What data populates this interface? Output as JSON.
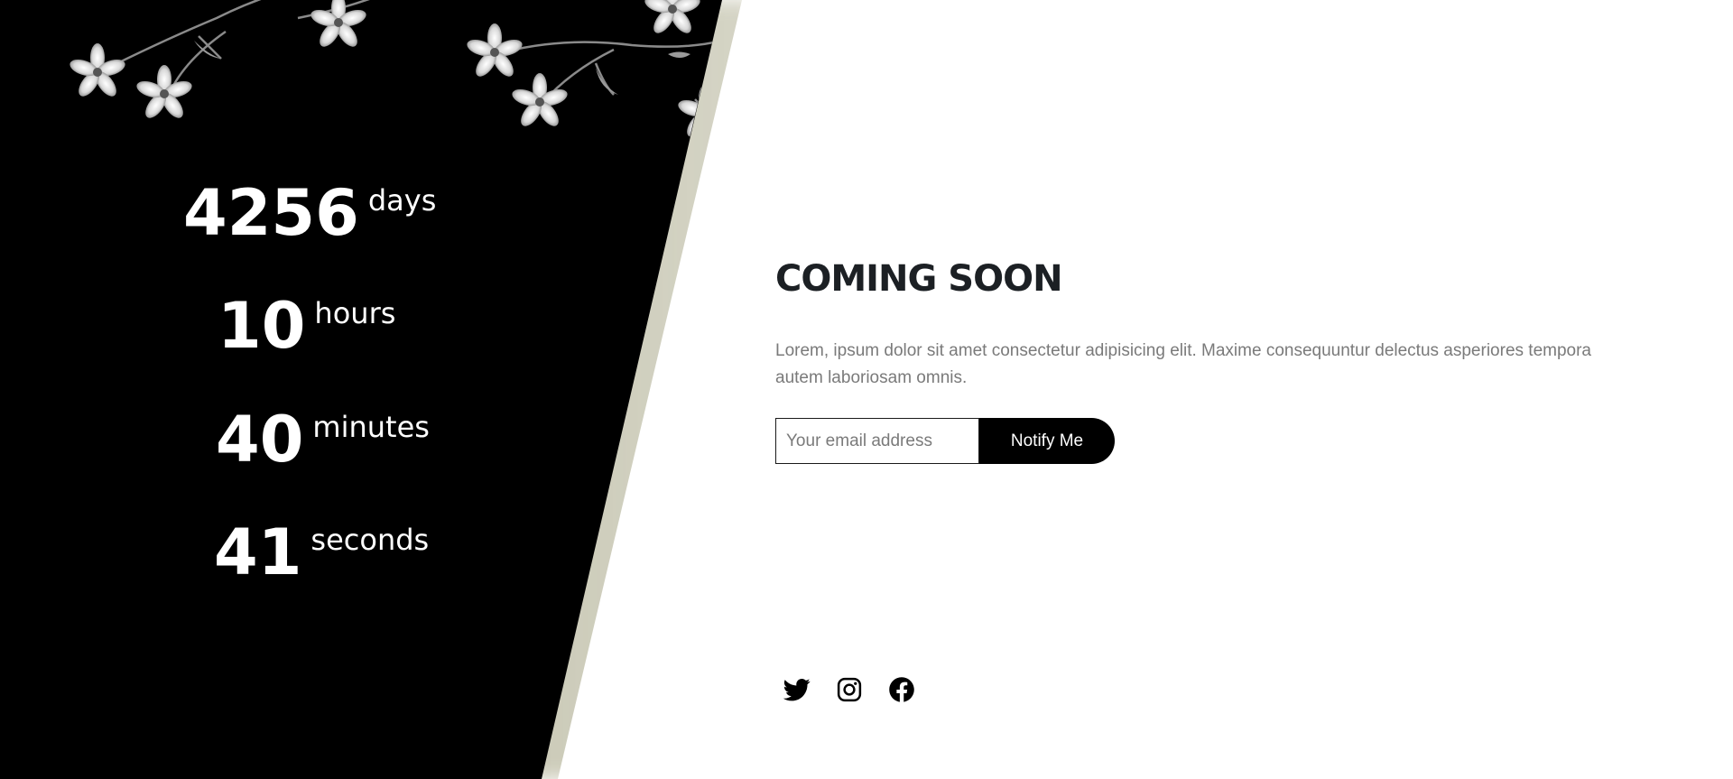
{
  "countdown": {
    "days": {
      "value": "4256",
      "unit": "days"
    },
    "hours": {
      "value": "10",
      "unit": "hours"
    },
    "minutes": {
      "value": "40",
      "unit": "minutes"
    },
    "seconds": {
      "value": "41",
      "unit": "seconds"
    }
  },
  "main": {
    "title": "COMING SOON",
    "description": "Lorem, ipsum dolor sit amet consectetur adipisicing elit. Maxime consequuntur delectus asperiores tempora autem laboriosam omnis.",
    "email_placeholder": "Your email address",
    "email_value": "",
    "notify_label": "Notify Me"
  },
  "social": [
    {
      "icon": "twitter-icon"
    },
    {
      "icon": "instagram-icon"
    },
    {
      "icon": "facebook-icon"
    }
  ],
  "colors": {
    "panel_background": "#000000",
    "page_background": "#ffffff",
    "title_color": "#1c2024",
    "text_muted": "#7a7a7a",
    "button_background": "#000000",
    "button_text": "#ffffff"
  }
}
